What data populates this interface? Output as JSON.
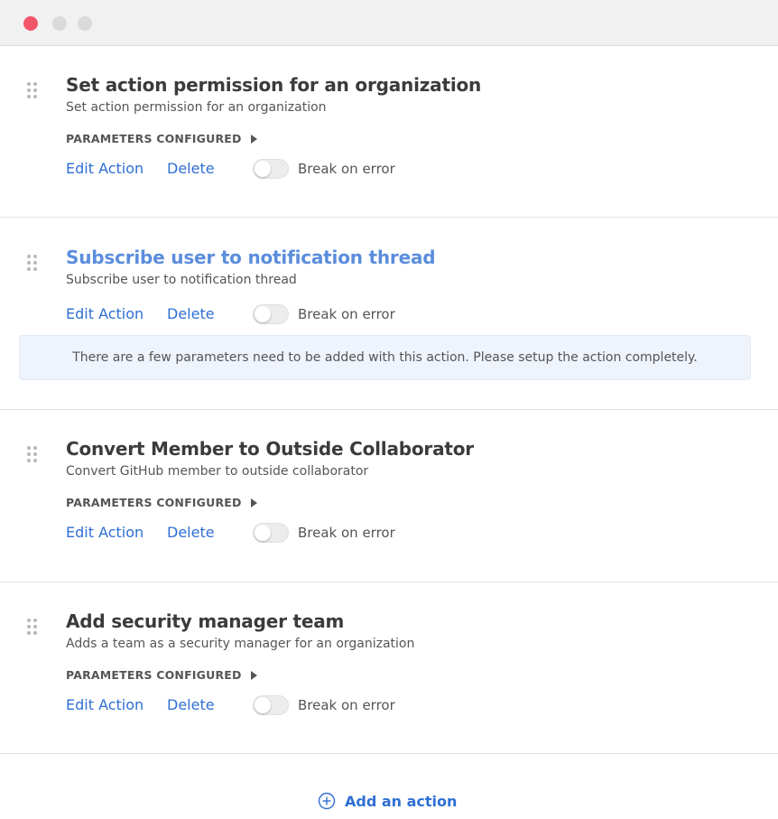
{
  "window": {
    "controls": [
      "close",
      "minimize",
      "maximize"
    ],
    "colors": {
      "close": "#f2566b",
      "inactive": "#dadada"
    }
  },
  "actions": [
    {
      "title": "Set action permission for an organization",
      "description": "Set action permission for an organization",
      "params_label": "PARAMETERS CONFIGURED",
      "edit_label": "Edit Action",
      "delete_label": "Delete",
      "toggle_label": "Break on error",
      "break_on_error": false
    },
    {
      "title": "Subscribe user to notification thread",
      "description": "Subscribe user to notification thread",
      "edit_label": "Edit Action",
      "delete_label": "Delete",
      "toggle_label": "Break on error",
      "break_on_error": false,
      "notice": "There are a few parameters need to be added with this action. Please setup the action completely."
    },
    {
      "title": "Convert Member to Outside Collaborator",
      "description": "Convert GitHub member to outside collaborator",
      "params_label": "PARAMETERS CONFIGURED",
      "edit_label": "Edit Action",
      "delete_label": "Delete",
      "toggle_label": "Break on error",
      "break_on_error": false
    },
    {
      "title": "Add security manager team",
      "description": "Adds a team as a security manager for an organization",
      "params_label": "PARAMETERS CONFIGURED",
      "edit_label": "Edit Action",
      "delete_label": "Delete",
      "toggle_label": "Break on error",
      "break_on_error": false
    }
  ],
  "footer": {
    "add_action_label": "Add an action",
    "add_action_icon": "plus-circle-icon"
  },
  "colors": {
    "link": "#2f6fd3",
    "highlight_title": "#5b8ddc",
    "notice_bg": "#eef3fc"
  }
}
